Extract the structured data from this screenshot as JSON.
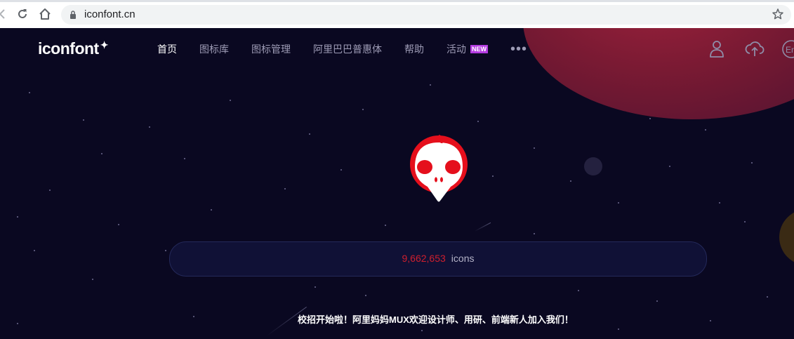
{
  "browser": {
    "url": "iconfont.cn",
    "icons": {
      "back": "back-arrow-icon",
      "reload": "reload-icon",
      "home": "home-icon",
      "lock": "lock-icon",
      "bookmark": "star-icon"
    }
  },
  "header": {
    "logo": "iconfont",
    "nav": [
      {
        "label": "首页",
        "active": true
      },
      {
        "label": "图标库"
      },
      {
        "label": "图标管理"
      },
      {
        "label": "阿里巴巴普惠体"
      },
      {
        "label": "帮助"
      },
      {
        "label": "活动",
        "badge": "NEW"
      }
    ],
    "more": "•••",
    "right_icons": [
      "user-icon",
      "upload-cloud-icon",
      "language-icon"
    ],
    "lang_partial": "En"
  },
  "hero": {
    "mascot": "skull-mascot",
    "search": {
      "count": "9,662,653",
      "unit": "icons"
    },
    "banner": "校招开始啦！阿里妈妈MUX欢迎设计师、用研、前端新人加入我们！"
  },
  "colors": {
    "background": "#0a0821",
    "accent_red": "#cf1f2e",
    "badge": "#b43ce0"
  }
}
